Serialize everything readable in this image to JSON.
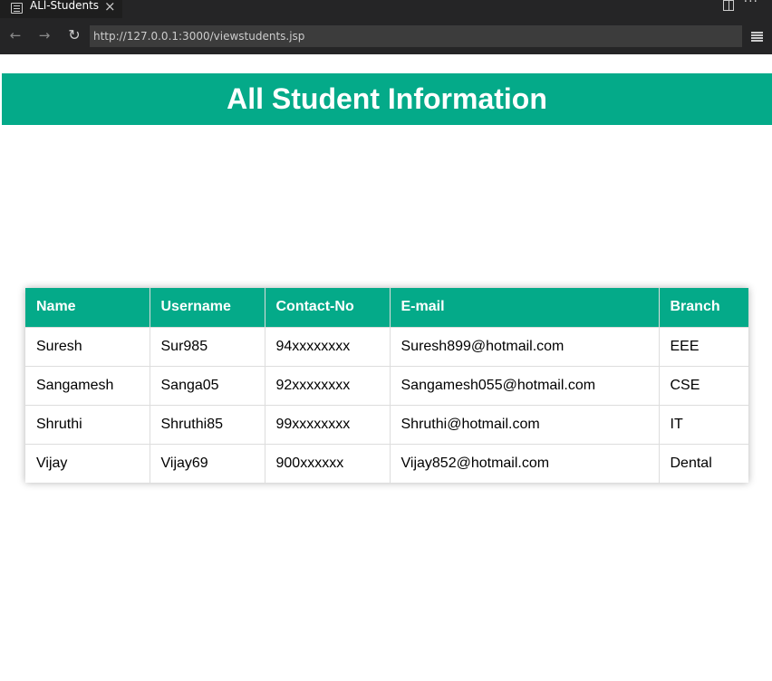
{
  "browser": {
    "tab_title": "ALl-Students",
    "url": "http://127.0.0.1:3000/viewstudents.jsp",
    "icons": [
      "page-icon",
      "close-icon",
      "split-editor-icon",
      "more-icon",
      "back-arrow-icon",
      "forward-arrow-icon",
      "reload-icon",
      "menu-icon"
    ]
  },
  "page": {
    "title": "All Student Information",
    "table": {
      "headers": [
        "Name",
        "Username",
        "Contact-No",
        "E-mail",
        "Branch"
      ],
      "rows": [
        [
          "Suresh",
          "Sur985",
          "94xxxxxxxx",
          "Suresh899@hotmail.com",
          "EEE"
        ],
        [
          "Sangamesh",
          "Sanga05",
          "92xxxxxxxx",
          "Sangamesh055@hotmail.com",
          "CSE"
        ],
        [
          "Shruthi",
          "Shruthi85",
          "99xxxxxxxx",
          "Shruthi@hotmail.com",
          "IT"
        ],
        [
          "Vijay",
          "Vijay69",
          "900xxxxxx",
          "Vijay852@hotmail.com",
          "Dental"
        ]
      ]
    }
  },
  "colors": {
    "accent": "#04aa89",
    "chrome_dark": "#252526",
    "url_bar": "#3c3c3c"
  }
}
